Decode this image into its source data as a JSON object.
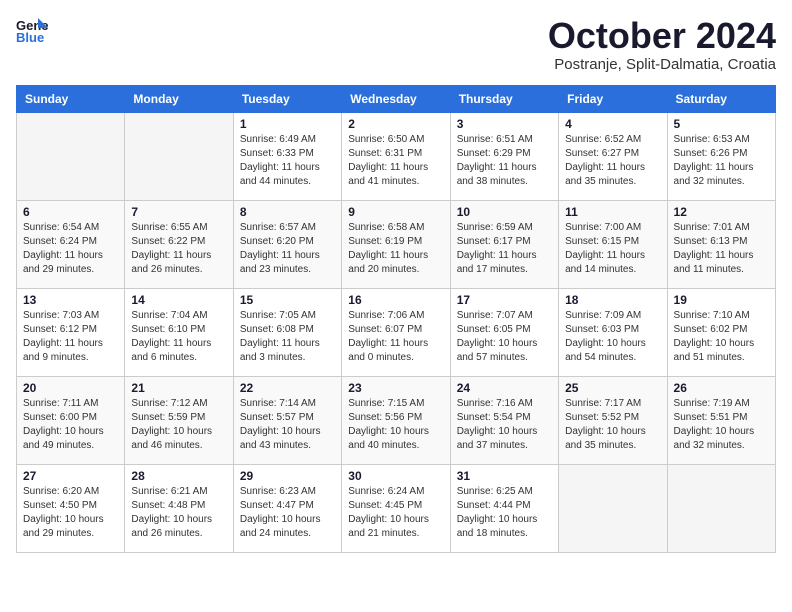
{
  "header": {
    "logo_line1": "General",
    "logo_line2": "Blue",
    "month_title": "October 2024",
    "location": "Postranje, Split-Dalmatia, Croatia"
  },
  "weekdays": [
    "Sunday",
    "Monday",
    "Tuesday",
    "Wednesday",
    "Thursday",
    "Friday",
    "Saturday"
  ],
  "weeks": [
    [
      {
        "day": "",
        "sunrise": "",
        "sunset": "",
        "daylight": ""
      },
      {
        "day": "",
        "sunrise": "",
        "sunset": "",
        "daylight": ""
      },
      {
        "day": "1",
        "sunrise": "Sunrise: 6:49 AM",
        "sunset": "Sunset: 6:33 PM",
        "daylight": "Daylight: 11 hours and 44 minutes."
      },
      {
        "day": "2",
        "sunrise": "Sunrise: 6:50 AM",
        "sunset": "Sunset: 6:31 PM",
        "daylight": "Daylight: 11 hours and 41 minutes."
      },
      {
        "day": "3",
        "sunrise": "Sunrise: 6:51 AM",
        "sunset": "Sunset: 6:29 PM",
        "daylight": "Daylight: 11 hours and 38 minutes."
      },
      {
        "day": "4",
        "sunrise": "Sunrise: 6:52 AM",
        "sunset": "Sunset: 6:27 PM",
        "daylight": "Daylight: 11 hours and 35 minutes."
      },
      {
        "day": "5",
        "sunrise": "Sunrise: 6:53 AM",
        "sunset": "Sunset: 6:26 PM",
        "daylight": "Daylight: 11 hours and 32 minutes."
      }
    ],
    [
      {
        "day": "6",
        "sunrise": "Sunrise: 6:54 AM",
        "sunset": "Sunset: 6:24 PM",
        "daylight": "Daylight: 11 hours and 29 minutes."
      },
      {
        "day": "7",
        "sunrise": "Sunrise: 6:55 AM",
        "sunset": "Sunset: 6:22 PM",
        "daylight": "Daylight: 11 hours and 26 minutes."
      },
      {
        "day": "8",
        "sunrise": "Sunrise: 6:57 AM",
        "sunset": "Sunset: 6:20 PM",
        "daylight": "Daylight: 11 hours and 23 minutes."
      },
      {
        "day": "9",
        "sunrise": "Sunrise: 6:58 AM",
        "sunset": "Sunset: 6:19 PM",
        "daylight": "Daylight: 11 hours and 20 minutes."
      },
      {
        "day": "10",
        "sunrise": "Sunrise: 6:59 AM",
        "sunset": "Sunset: 6:17 PM",
        "daylight": "Daylight: 11 hours and 17 minutes."
      },
      {
        "day": "11",
        "sunrise": "Sunrise: 7:00 AM",
        "sunset": "Sunset: 6:15 PM",
        "daylight": "Daylight: 11 hours and 14 minutes."
      },
      {
        "day": "12",
        "sunrise": "Sunrise: 7:01 AM",
        "sunset": "Sunset: 6:13 PM",
        "daylight": "Daylight: 11 hours and 11 minutes."
      }
    ],
    [
      {
        "day": "13",
        "sunrise": "Sunrise: 7:03 AM",
        "sunset": "Sunset: 6:12 PM",
        "daylight": "Daylight: 11 hours and 9 minutes."
      },
      {
        "day": "14",
        "sunrise": "Sunrise: 7:04 AM",
        "sunset": "Sunset: 6:10 PM",
        "daylight": "Daylight: 11 hours and 6 minutes."
      },
      {
        "day": "15",
        "sunrise": "Sunrise: 7:05 AM",
        "sunset": "Sunset: 6:08 PM",
        "daylight": "Daylight: 11 hours and 3 minutes."
      },
      {
        "day": "16",
        "sunrise": "Sunrise: 7:06 AM",
        "sunset": "Sunset: 6:07 PM",
        "daylight": "Daylight: 11 hours and 0 minutes."
      },
      {
        "day": "17",
        "sunrise": "Sunrise: 7:07 AM",
        "sunset": "Sunset: 6:05 PM",
        "daylight": "Daylight: 10 hours and 57 minutes."
      },
      {
        "day": "18",
        "sunrise": "Sunrise: 7:09 AM",
        "sunset": "Sunset: 6:03 PM",
        "daylight": "Daylight: 10 hours and 54 minutes."
      },
      {
        "day": "19",
        "sunrise": "Sunrise: 7:10 AM",
        "sunset": "Sunset: 6:02 PM",
        "daylight": "Daylight: 10 hours and 51 minutes."
      }
    ],
    [
      {
        "day": "20",
        "sunrise": "Sunrise: 7:11 AM",
        "sunset": "Sunset: 6:00 PM",
        "daylight": "Daylight: 10 hours and 49 minutes."
      },
      {
        "day": "21",
        "sunrise": "Sunrise: 7:12 AM",
        "sunset": "Sunset: 5:59 PM",
        "daylight": "Daylight: 10 hours and 46 minutes."
      },
      {
        "day": "22",
        "sunrise": "Sunrise: 7:14 AM",
        "sunset": "Sunset: 5:57 PM",
        "daylight": "Daylight: 10 hours and 43 minutes."
      },
      {
        "day": "23",
        "sunrise": "Sunrise: 7:15 AM",
        "sunset": "Sunset: 5:56 PM",
        "daylight": "Daylight: 10 hours and 40 minutes."
      },
      {
        "day": "24",
        "sunrise": "Sunrise: 7:16 AM",
        "sunset": "Sunset: 5:54 PM",
        "daylight": "Daylight: 10 hours and 37 minutes."
      },
      {
        "day": "25",
        "sunrise": "Sunrise: 7:17 AM",
        "sunset": "Sunset: 5:52 PM",
        "daylight": "Daylight: 10 hours and 35 minutes."
      },
      {
        "day": "26",
        "sunrise": "Sunrise: 7:19 AM",
        "sunset": "Sunset: 5:51 PM",
        "daylight": "Daylight: 10 hours and 32 minutes."
      }
    ],
    [
      {
        "day": "27",
        "sunrise": "Sunrise: 6:20 AM",
        "sunset": "Sunset: 4:50 PM",
        "daylight": "Daylight: 10 hours and 29 minutes."
      },
      {
        "day": "28",
        "sunrise": "Sunrise: 6:21 AM",
        "sunset": "Sunset: 4:48 PM",
        "daylight": "Daylight: 10 hours and 26 minutes."
      },
      {
        "day": "29",
        "sunrise": "Sunrise: 6:23 AM",
        "sunset": "Sunset: 4:47 PM",
        "daylight": "Daylight: 10 hours and 24 minutes."
      },
      {
        "day": "30",
        "sunrise": "Sunrise: 6:24 AM",
        "sunset": "Sunset: 4:45 PM",
        "daylight": "Daylight: 10 hours and 21 minutes."
      },
      {
        "day": "31",
        "sunrise": "Sunrise: 6:25 AM",
        "sunset": "Sunset: 4:44 PM",
        "daylight": "Daylight: 10 hours and 18 minutes."
      },
      {
        "day": "",
        "sunrise": "",
        "sunset": "",
        "daylight": ""
      },
      {
        "day": "",
        "sunrise": "",
        "sunset": "",
        "daylight": ""
      }
    ]
  ]
}
